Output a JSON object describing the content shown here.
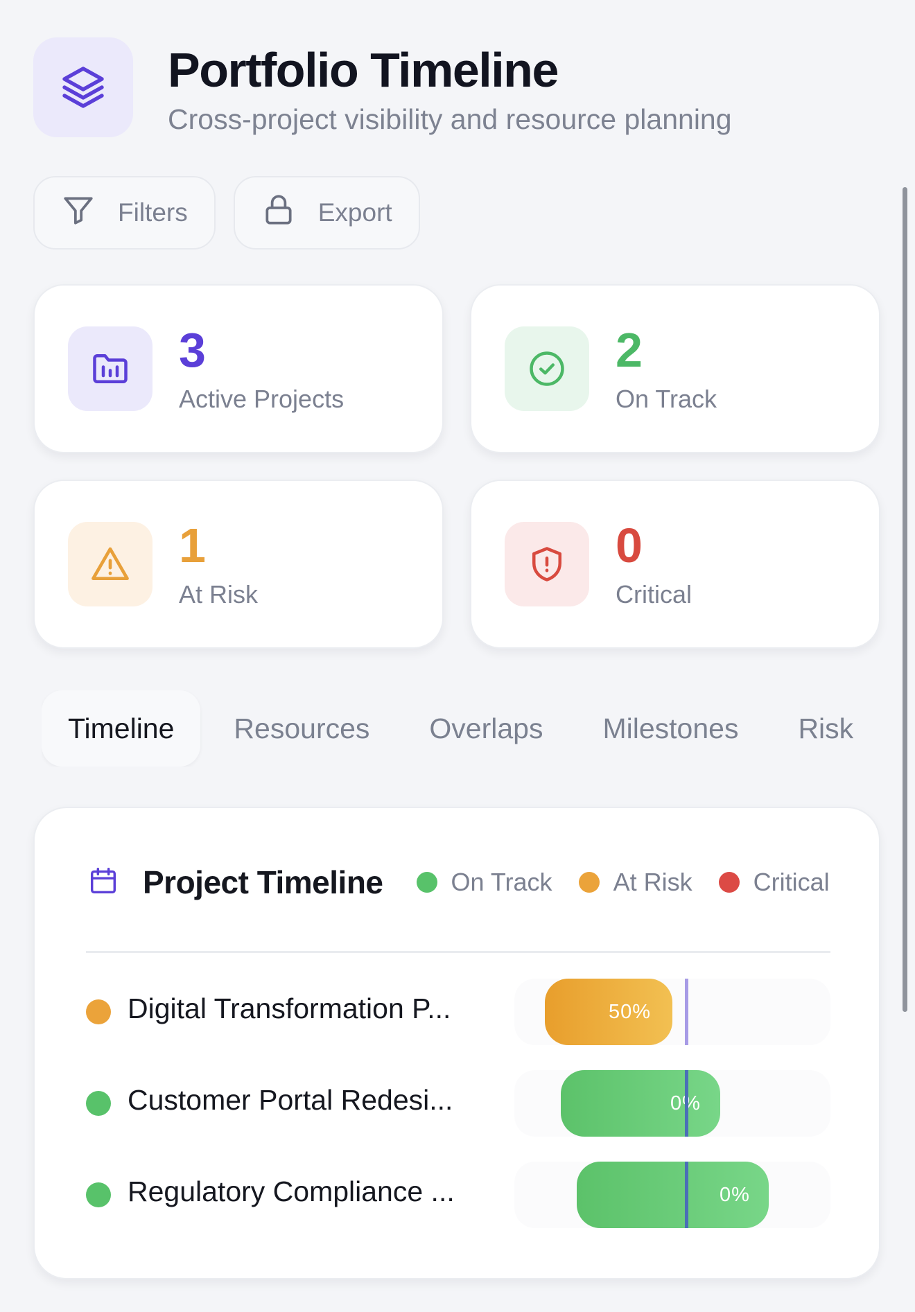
{
  "header": {
    "title": "Portfolio Timeline",
    "subtitle": "Cross-project visibility and resource planning",
    "icon": "layers-icon"
  },
  "toolbar": {
    "filters_label": "Filters",
    "export_label": "Export"
  },
  "stats": [
    {
      "value": "3",
      "label": "Active Projects",
      "color": "#5b3fd8",
      "bg": "#ebe9fb",
      "icon": "folder-chart-icon"
    },
    {
      "value": "2",
      "label": "On Track",
      "color": "#4cb866",
      "bg": "#e8f6ec",
      "icon": "check-circle-icon"
    },
    {
      "value": "1",
      "label": "At Risk",
      "color": "#e8a03a",
      "bg": "#fdf1e3",
      "icon": "warning-triangle-icon"
    },
    {
      "value": "0",
      "label": "Critical",
      "color": "#d84a3f",
      "bg": "#fbe9e9",
      "icon": "shield-alert-icon"
    }
  ],
  "tabs": [
    {
      "label": "Timeline",
      "active": true
    },
    {
      "label": "Resources",
      "active": false
    },
    {
      "label": "Overlaps",
      "active": false
    },
    {
      "label": "Milestones",
      "active": false
    },
    {
      "label": "Risk",
      "active": false
    }
  ],
  "timeline": {
    "title": "Project Timeline",
    "legend": [
      {
        "label": "On Track",
        "color": "#58c26a"
      },
      {
        "label": "At Risk",
        "color": "#eba33a"
      },
      {
        "label": "Critical",
        "color": "#dc4a45"
      }
    ],
    "projects": [
      {
        "name": "Digital Transformation P...",
        "status_color": "#eba33a",
        "progress_label": "50%",
        "progress": 0.5
      },
      {
        "name": "Customer Portal Redesi...",
        "status_color": "#58c26a",
        "progress_label": "0%",
        "progress": 0
      },
      {
        "name": "Regulatory Compliance ...",
        "status_color": "#58c26a",
        "progress_label": "0%",
        "progress": 0
      }
    ]
  },
  "colors": {
    "accent": "#5b3fd8",
    "today_line": "#9a8fe0"
  }
}
